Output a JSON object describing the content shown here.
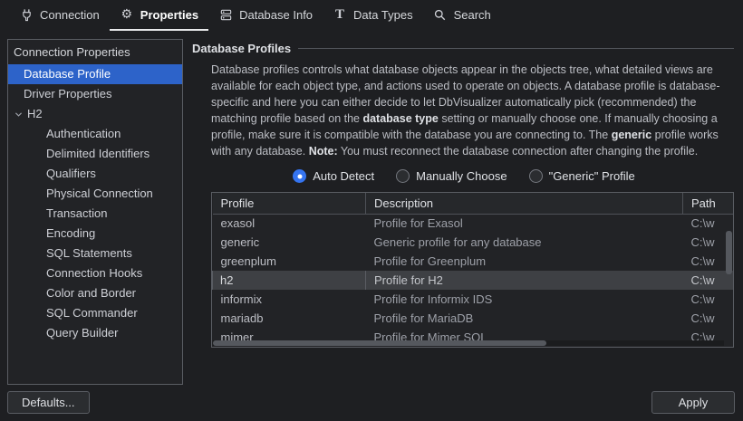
{
  "theme": {
    "accent_blue": "#3574f0",
    "selection_blue": "#2d63c9",
    "background": "#1e1f22",
    "panel_border": "#5a5d63"
  },
  "topbar": {
    "tabs": [
      {
        "label": "Connection",
        "icon": "plug-icon",
        "active": false
      },
      {
        "label": "Properties",
        "icon": "gear-icon",
        "active": true
      },
      {
        "label": "Database Info",
        "icon": "server-icon",
        "active": false
      },
      {
        "label": "Data Types",
        "icon": "type-icon",
        "active": false
      },
      {
        "label": "Search",
        "icon": "search-icon",
        "active": false
      }
    ]
  },
  "sidebar": {
    "header": "Connection Properties",
    "items": [
      {
        "label": "Database Profile",
        "level": 1,
        "selected": true
      },
      {
        "label": "Driver Properties",
        "level": 1,
        "selected": false
      },
      {
        "label": "H2",
        "level": 0,
        "expanded": true,
        "selected": false
      },
      {
        "label": "Authentication",
        "level": 2,
        "selected": false
      },
      {
        "label": "Delimited Identifiers",
        "level": 2,
        "selected": false
      },
      {
        "label": "Qualifiers",
        "level": 2,
        "selected": false
      },
      {
        "label": "Physical Connection",
        "level": 2,
        "selected": false
      },
      {
        "label": "Transaction",
        "level": 2,
        "selected": false
      },
      {
        "label": "Encoding",
        "level": 2,
        "selected": false
      },
      {
        "label": "SQL Statements",
        "level": 2,
        "selected": false
      },
      {
        "label": "Connection Hooks",
        "level": 2,
        "selected": false
      },
      {
        "label": "Color and Border",
        "level": 2,
        "selected": false
      },
      {
        "label": "SQL Commander",
        "level": 2,
        "selected": false
      },
      {
        "label": "Query Builder",
        "level": 2,
        "selected": false
      }
    ],
    "defaults_label": "Defaults..."
  },
  "main": {
    "section_title": "Database Profiles",
    "description": {
      "p1": "Database profiles controls what database objects appear in the objects tree, what detailed views are available for each object type, and actions used to operate on objects. A database profile is database-specific and here you can either decide to let DbVisualizer automatically pick (recommended) the matching profile based on the ",
      "b1": "database type",
      "p2": " setting or manually choose one. If manually choosing a profile, make sure it is compatible with the database you are connecting to. The ",
      "b2": "generic",
      "p3": " profile works with any database. ",
      "b3": "Note:",
      "p4": " You must reconnect the database connection after changing the profile."
    },
    "radios": [
      {
        "label": "Auto Detect",
        "selected": true
      },
      {
        "label": "Manually Choose",
        "selected": false
      },
      {
        "label": "\"Generic\" Profile",
        "selected": false
      }
    ],
    "table": {
      "columns": [
        "Profile",
        "Description",
        "Path"
      ],
      "rows": [
        [
          "exasol",
          "Profile for Exasol",
          "C:\\w"
        ],
        [
          "generic",
          "Generic profile for any database",
          "C:\\w"
        ],
        [
          "greenplum",
          "Profile for Greenplum",
          "C:\\w"
        ],
        [
          "h2",
          "Profile for H2",
          "C:\\w"
        ],
        [
          "informix",
          "Profile for Informix IDS",
          "C:\\w"
        ],
        [
          "mariadb",
          "Profile for MariaDB",
          "C:\\w"
        ],
        [
          "mimer",
          "Profile for Mimer SQL",
          "C:\\w"
        ]
      ],
      "selected_row_index": 3
    },
    "apply_label": "Apply"
  }
}
